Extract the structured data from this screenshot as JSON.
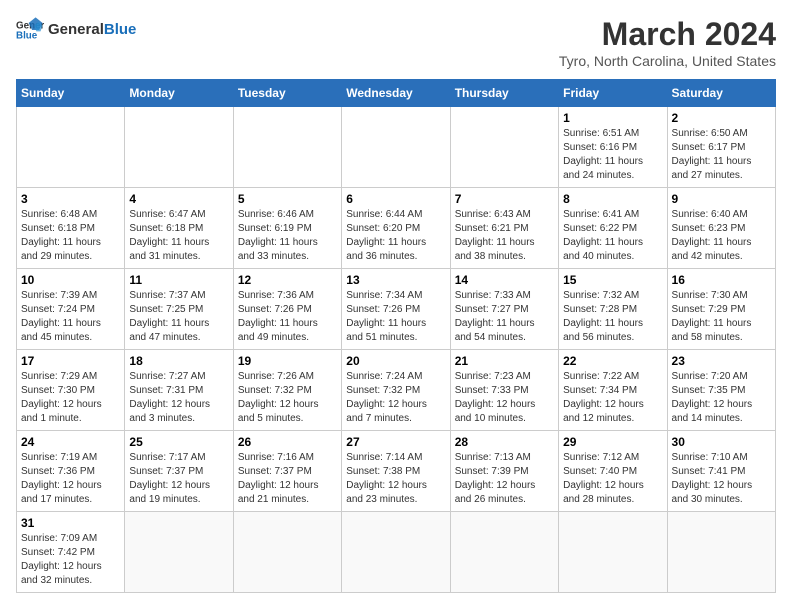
{
  "header": {
    "logo_general": "General",
    "logo_blue": "Blue",
    "month_title": "March 2024",
    "location": "Tyro, North Carolina, United States"
  },
  "weekdays": [
    "Sunday",
    "Monday",
    "Tuesday",
    "Wednesday",
    "Thursday",
    "Friday",
    "Saturday"
  ],
  "weeks": [
    [
      {
        "day": "",
        "info": ""
      },
      {
        "day": "",
        "info": ""
      },
      {
        "day": "",
        "info": ""
      },
      {
        "day": "",
        "info": ""
      },
      {
        "day": "",
        "info": ""
      },
      {
        "day": "1",
        "info": "Sunrise: 6:51 AM\nSunset: 6:16 PM\nDaylight: 11 hours\nand 24 minutes."
      },
      {
        "day": "2",
        "info": "Sunrise: 6:50 AM\nSunset: 6:17 PM\nDaylight: 11 hours\nand 27 minutes."
      }
    ],
    [
      {
        "day": "3",
        "info": "Sunrise: 6:48 AM\nSunset: 6:18 PM\nDaylight: 11 hours\nand 29 minutes."
      },
      {
        "day": "4",
        "info": "Sunrise: 6:47 AM\nSunset: 6:18 PM\nDaylight: 11 hours\nand 31 minutes."
      },
      {
        "day": "5",
        "info": "Sunrise: 6:46 AM\nSunset: 6:19 PM\nDaylight: 11 hours\nand 33 minutes."
      },
      {
        "day": "6",
        "info": "Sunrise: 6:44 AM\nSunset: 6:20 PM\nDaylight: 11 hours\nand 36 minutes."
      },
      {
        "day": "7",
        "info": "Sunrise: 6:43 AM\nSunset: 6:21 PM\nDaylight: 11 hours\nand 38 minutes."
      },
      {
        "day": "8",
        "info": "Sunrise: 6:41 AM\nSunset: 6:22 PM\nDaylight: 11 hours\nand 40 minutes."
      },
      {
        "day": "9",
        "info": "Sunrise: 6:40 AM\nSunset: 6:23 PM\nDaylight: 11 hours\nand 42 minutes."
      }
    ],
    [
      {
        "day": "10",
        "info": "Sunrise: 7:39 AM\nSunset: 7:24 PM\nDaylight: 11 hours\nand 45 minutes."
      },
      {
        "day": "11",
        "info": "Sunrise: 7:37 AM\nSunset: 7:25 PM\nDaylight: 11 hours\nand 47 minutes."
      },
      {
        "day": "12",
        "info": "Sunrise: 7:36 AM\nSunset: 7:26 PM\nDaylight: 11 hours\nand 49 minutes."
      },
      {
        "day": "13",
        "info": "Sunrise: 7:34 AM\nSunset: 7:26 PM\nDaylight: 11 hours\nand 51 minutes."
      },
      {
        "day": "14",
        "info": "Sunrise: 7:33 AM\nSunset: 7:27 PM\nDaylight: 11 hours\nand 54 minutes."
      },
      {
        "day": "15",
        "info": "Sunrise: 7:32 AM\nSunset: 7:28 PM\nDaylight: 11 hours\nand 56 minutes."
      },
      {
        "day": "16",
        "info": "Sunrise: 7:30 AM\nSunset: 7:29 PM\nDaylight: 11 hours\nand 58 minutes."
      }
    ],
    [
      {
        "day": "17",
        "info": "Sunrise: 7:29 AM\nSunset: 7:30 PM\nDaylight: 12 hours\nand 1 minute."
      },
      {
        "day": "18",
        "info": "Sunrise: 7:27 AM\nSunset: 7:31 PM\nDaylight: 12 hours\nand 3 minutes."
      },
      {
        "day": "19",
        "info": "Sunrise: 7:26 AM\nSunset: 7:32 PM\nDaylight: 12 hours\nand 5 minutes."
      },
      {
        "day": "20",
        "info": "Sunrise: 7:24 AM\nSunset: 7:32 PM\nDaylight: 12 hours\nand 7 minutes."
      },
      {
        "day": "21",
        "info": "Sunrise: 7:23 AM\nSunset: 7:33 PM\nDaylight: 12 hours\nand 10 minutes."
      },
      {
        "day": "22",
        "info": "Sunrise: 7:22 AM\nSunset: 7:34 PM\nDaylight: 12 hours\nand 12 minutes."
      },
      {
        "day": "23",
        "info": "Sunrise: 7:20 AM\nSunset: 7:35 PM\nDaylight: 12 hours\nand 14 minutes."
      }
    ],
    [
      {
        "day": "24",
        "info": "Sunrise: 7:19 AM\nSunset: 7:36 PM\nDaylight: 12 hours\nand 17 minutes."
      },
      {
        "day": "25",
        "info": "Sunrise: 7:17 AM\nSunset: 7:37 PM\nDaylight: 12 hours\nand 19 minutes."
      },
      {
        "day": "26",
        "info": "Sunrise: 7:16 AM\nSunset: 7:37 PM\nDaylight: 12 hours\nand 21 minutes."
      },
      {
        "day": "27",
        "info": "Sunrise: 7:14 AM\nSunset: 7:38 PM\nDaylight: 12 hours\nand 23 minutes."
      },
      {
        "day": "28",
        "info": "Sunrise: 7:13 AM\nSunset: 7:39 PM\nDaylight: 12 hours\nand 26 minutes."
      },
      {
        "day": "29",
        "info": "Sunrise: 7:12 AM\nSunset: 7:40 PM\nDaylight: 12 hours\nand 28 minutes."
      },
      {
        "day": "30",
        "info": "Sunrise: 7:10 AM\nSunset: 7:41 PM\nDaylight: 12 hours\nand 30 minutes."
      }
    ],
    [
      {
        "day": "31",
        "info": "Sunrise: 7:09 AM\nSunset: 7:42 PM\nDaylight: 12 hours\nand 32 minutes."
      },
      {
        "day": "",
        "info": ""
      },
      {
        "day": "",
        "info": ""
      },
      {
        "day": "",
        "info": ""
      },
      {
        "day": "",
        "info": ""
      },
      {
        "day": "",
        "info": ""
      },
      {
        "day": "",
        "info": ""
      }
    ]
  ]
}
